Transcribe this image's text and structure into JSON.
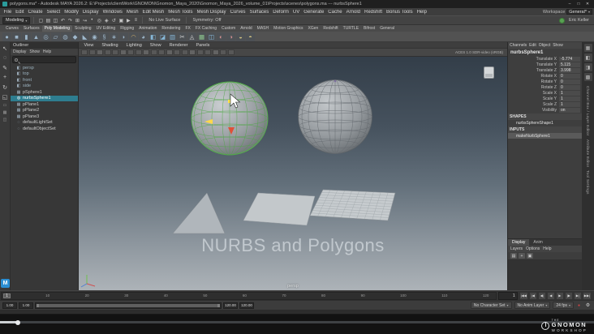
{
  "glyphs": {
    "caret": "▾"
  },
  "maya_badge": "M",
  "titlebar": {
    "title": "polygons.ma* - Autodesk MAYA 2026.2: E:\\Projects\\clientWork\\GNOMON\\Gnomon_Maya_2020\\Gnomon_Maya_2026_volume_01\\Projects\\scenes\\polygons.ma --- nurbsSphere1",
    "window_buttons": [
      "–",
      "□",
      "✕"
    ]
  },
  "menubar": {
    "menus": [
      "File",
      "Edit",
      "Create",
      "Select",
      "Modify",
      "Display",
      "Windows",
      "Mesh",
      "Edit Mesh",
      "Mesh Tools",
      "Mesh Display",
      "Curves",
      "Surfaces",
      "Deform",
      "UV",
      "Generate",
      "Cache",
      "Arnold",
      "Redshift",
      "Bonus Tools",
      "Help"
    ],
    "workspace_label": "Workspace",
    "workspace_value": "General*"
  },
  "statusline": {
    "mode": "Modeling",
    "no_live_surface": "No Live Surface",
    "symmetry": "Symmetry: Off",
    "user": "Eric Keller",
    "icons": [
      {
        "name": "new-scene-icon",
        "glyph": "▢"
      },
      {
        "name": "open-scene-icon",
        "glyph": "▤"
      },
      {
        "name": "save-scene-icon",
        "glyph": "◫"
      },
      {
        "name": "undo-icon",
        "glyph": "↶"
      },
      {
        "name": "redo-icon",
        "glyph": "↷"
      },
      {
        "name": "snap-to-grid-icon",
        "glyph": "⊞"
      },
      {
        "name": "snap-to-curve-icon",
        "glyph": "↝"
      },
      {
        "name": "snap-to-point-icon",
        "glyph": "•"
      },
      {
        "name": "snap-to-view-plane-icon",
        "glyph": "◎"
      },
      {
        "name": "make-live-icon",
        "glyph": "◈"
      },
      {
        "name": "construction-history-icon",
        "glyph": "↺"
      },
      {
        "name": "render-current-frame-icon",
        "glyph": "▣"
      },
      {
        "name": "ipr-render-icon",
        "glyph": "▶"
      },
      {
        "name": "render-settings-icon",
        "glyph": "≡"
      }
    ]
  },
  "shelf": {
    "active_tab": "Poly Modeling",
    "tabs": [
      "Curves",
      "Surfaces",
      "Poly Modeling",
      "Sculpting",
      "UV Editing",
      "Rigging",
      "Animation",
      "Rendering",
      "FX",
      "FX Caching",
      "Custom",
      "Arnold",
      "MASH",
      "Motion Graphics",
      "XGen",
      "Redshift",
      "TURTLE",
      "Bifrost",
      "General"
    ],
    "icons": [
      {
        "name": "polygon-sphere-icon",
        "glyph": "●",
        "color": "#9fb8cc"
      },
      {
        "name": "polygon-cube-icon",
        "glyph": "■",
        "color": "#9fb8cc"
      },
      {
        "name": "polygon-cylinder-icon",
        "glyph": "▮",
        "color": "#9fb8cc"
      },
      {
        "name": "polygon-cone-icon",
        "glyph": "▲",
        "color": "#9fb8cc"
      },
      {
        "name": "polygon-torus-icon",
        "glyph": "◎",
        "color": "#9fb8cc"
      },
      {
        "name": "polygon-plane-icon",
        "glyph": "▱",
        "color": "#9fb8cc"
      },
      {
        "name": "polygon-disc-icon",
        "glyph": "◍",
        "color": "#9fb8cc"
      },
      {
        "name": "platonic-solid-icon",
        "glyph": "◆",
        "color": "#9fb8cc"
      },
      {
        "name": "polygon-pyramid-icon",
        "glyph": "◣",
        "color": "#9fb8cc"
      },
      {
        "name": "polygon-pipe-icon",
        "glyph": "◉",
        "color": "#9fb8cc"
      },
      {
        "name": "polygon-helix-icon",
        "glyph": "§",
        "color": "#9fb8cc"
      },
      {
        "name": "polygon-gear-icon",
        "glyph": "∗",
        "color": "#9fb8cc"
      },
      {
        "name": "super-ellipse-icon",
        "glyph": "◗",
        "color": "#9fb8cc"
      },
      {
        "name": "sculpt-tool-icon",
        "glyph": "◠",
        "color": "#c9a86a"
      },
      {
        "name": "smooth-mesh-icon",
        "glyph": "◕",
        "color": "#9fb8cc"
      },
      {
        "name": "extrude-icon",
        "glyph": "◧",
        "color": "#86b7d7"
      },
      {
        "name": "bevel-icon",
        "glyph": "◪",
        "color": "#86b7d7"
      },
      {
        "name": "bridge-icon",
        "glyph": "▥",
        "color": "#86b7d7"
      },
      {
        "name": "multi-cut-icon",
        "glyph": "✂",
        "color": "#d0d0d0"
      },
      {
        "name": "target-weld-icon",
        "glyph": "◬",
        "color": "#d0d0d0"
      },
      {
        "name": "quad-draw-icon",
        "glyph": "▦",
        "color": "#8fc98f"
      },
      {
        "name": "mirror-icon",
        "glyph": "◫",
        "color": "#86b7d7"
      },
      {
        "name": "boolean-union-icon",
        "glyph": "◐",
        "color": "#d09090"
      },
      {
        "name": "boolean-difference-icon",
        "glyph": "◑",
        "color": "#d09090"
      },
      {
        "name": "combine-icon",
        "glyph": "◒",
        "color": "#d0c080"
      },
      {
        "name": "separate-icon",
        "glyph": "◓",
        "color": "#d0c080"
      }
    ]
  },
  "toolbox": {
    "tools": [
      {
        "name": "select-tool-icon",
        "glyph": "↖"
      },
      {
        "name": "lasso-tool-icon",
        "glyph": "◌"
      },
      {
        "name": "paint-select-tool-icon",
        "glyph": "✎"
      },
      {
        "name": "move-tool-icon",
        "glyph": "+"
      },
      {
        "name": "rotate-tool-icon",
        "glyph": "↻"
      },
      {
        "name": "scale-tool-icon",
        "glyph": "◱"
      }
    ],
    "layouts": [
      {
        "name": "layout-single-pane-icon",
        "glyph": "▭"
      },
      {
        "name": "layout-four-pane-icon",
        "glyph": "▦"
      },
      {
        "name": "layout-persp-outliner-icon",
        "glyph": "◫"
      }
    ]
  },
  "outliner": {
    "title": "Outliner",
    "menus": [
      "Display",
      "Show",
      "Help"
    ],
    "search_placeholder": "",
    "items": [
      {
        "label": "persp",
        "type": "camera"
      },
      {
        "label": "top",
        "type": "camera"
      },
      {
        "label": "front",
        "type": "camera"
      },
      {
        "label": "side",
        "type": "camera"
      },
      {
        "label": "pSphere1",
        "type": "mesh"
      },
      {
        "label": "nurbsSphere1",
        "type": "nurbs",
        "selected": true
      },
      {
        "label": "pPlane1",
        "type": "mesh"
      },
      {
        "label": "pPlane2",
        "type": "mesh"
      },
      {
        "label": "pPlane3",
        "type": "mesh"
      },
      {
        "label": "defaultLightSet",
        "type": "set"
      },
      {
        "label": "defaultObjectSet",
        "type": "set"
      }
    ]
  },
  "viewport": {
    "menus": [
      "View",
      "Shading",
      "Lighting",
      "Show",
      "Renderer",
      "Panels"
    ],
    "toolbar_icons": [
      "select-camera-icon",
      "lock-camera-icon",
      "camera-attributes-icon",
      "bookmarks-icon",
      "image-plane-icon",
      "wireframe-mode-icon",
      "shaded-mode-icon",
      "textured-mode-icon",
      "use-all-lights-icon",
      "shadows-icon",
      "ambient-occlusion-icon",
      "motion-blur-icon",
      "multisample-aa-icon",
      "depth-of-field-icon",
      "isolate-select-icon",
      "xray-mode-icon",
      "joint-xray-icon",
      "exposure-icon",
      "gamma-icon",
      "view-transform-icon"
    ],
    "colorspace": "ACES 1.0 SDR-video (sRGB)",
    "camera_label": "persp",
    "watermark": "NURBS and Polygons"
  },
  "channelbox": {
    "menus": [
      "Channels",
      "Edit",
      "Object",
      "Show"
    ],
    "object_name": "nurbsSphere1",
    "attributes": [
      {
        "label": "Translate X",
        "value": "-5.774"
      },
      {
        "label": "Translate Y",
        "value": "5.115"
      },
      {
        "label": "Translate Z",
        "value": "3.998"
      },
      {
        "label": "Rotate X",
        "value": "0"
      },
      {
        "label": "Rotate Y",
        "value": "0"
      },
      {
        "label": "Rotate Z",
        "value": "0"
      },
      {
        "label": "Scale X",
        "value": "1"
      },
      {
        "label": "Scale Y",
        "value": "1"
      },
      {
        "label": "Scale Z",
        "value": "1"
      },
      {
        "label": "Visibility",
        "value": "on"
      }
    ],
    "shapes_header": "SHAPES",
    "shape_name": "nurbsSphereShape1",
    "inputs_header": "INPUTS",
    "input_name": "makeNurbSphere1"
  },
  "layer_editor": {
    "tabs": [
      "Display",
      "Anim"
    ],
    "menus": [
      "Layers",
      "Options",
      "Help"
    ],
    "icons": [
      {
        "name": "layers-toggle-icon",
        "glyph": "▤"
      },
      {
        "name": "new-empty-layer-icon",
        "glyph": "+"
      },
      {
        "name": "new-layer-from-selected-icon",
        "glyph": "▣"
      }
    ]
  },
  "right_strip": {
    "icons": [
      {
        "name": "channel-box-tab-icon",
        "glyph": "▦"
      },
      {
        "name": "attribute-editor-tab-icon",
        "glyph": "◧"
      },
      {
        "name": "tool-settings-tab-icon",
        "glyph": "◨"
      },
      {
        "name": "modeling-toolkit-tab-icon",
        "glyph": "▩"
      }
    ],
    "labels": [
      "Channel Box / Layer Editor",
      "Attribute Editor",
      "Tool Settings"
    ]
  },
  "timeline": {
    "ticks": [
      "1",
      "10",
      "20",
      "30",
      "40",
      "50",
      "60",
      "70",
      "80",
      "90",
      "100",
      "110",
      "120"
    ],
    "current_frame": "1",
    "current_time": "1",
    "range_start": "1.00",
    "playback_start": "1.00",
    "playback_end": "120.00",
    "range_end": "120.00",
    "character_set": "No Character Set",
    "anim_layer": "No Anim Layer",
    "fps": "24 fps",
    "controls": [
      {
        "name": "go-to-start-button",
        "glyph": "|◀◀"
      },
      {
        "name": "step-back-key-button",
        "glyph": "|◀"
      },
      {
        "name": "step-back-frame-button",
        "glyph": "◀|"
      },
      {
        "name": "play-backwards-button",
        "glyph": "◀"
      },
      {
        "name": "play-forwards-button",
        "glyph": "▶"
      },
      {
        "name": "step-forward-frame-button",
        "glyph": "|▶"
      },
      {
        "name": "step-forward-key-button",
        "glyph": "▶|"
      },
      {
        "name": "go-to-end-button",
        "glyph": "▶▶|"
      }
    ]
  },
  "video_player": {
    "progress_percent": 3,
    "logo_the": "THE",
    "logo_gnomon": "GNOMON",
    "logo_workshop": "WORKSHOP"
  }
}
